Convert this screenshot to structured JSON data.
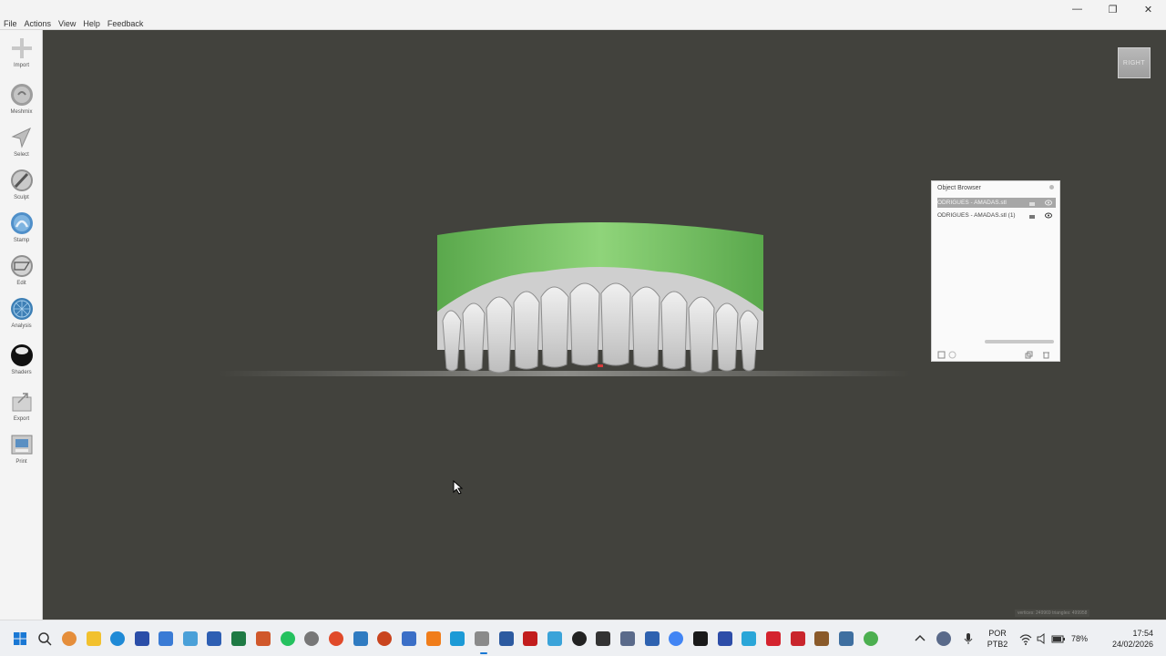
{
  "menu": [
    "File",
    "Actions",
    "View",
    "Help",
    "Feedback"
  ],
  "window_controls": {
    "minimize": "—",
    "restore": "❐",
    "close": "✕"
  },
  "tools": [
    {
      "label": "Import",
      "icon": "plus-icon"
    },
    {
      "label": "Meshmix",
      "icon": "meshmix-icon"
    },
    {
      "label": "Select",
      "icon": "select-arrow-icon"
    },
    {
      "label": "Sculpt",
      "icon": "brush-icon"
    },
    {
      "label": "Stamp",
      "icon": "stamp-icon"
    },
    {
      "label": "Edit",
      "icon": "edit-icon"
    },
    {
      "label": "Analysis",
      "icon": "analysis-icon"
    },
    {
      "label": "Shaders",
      "icon": "shader-sphere-icon"
    },
    {
      "label": "Export",
      "icon": "export-icon"
    },
    {
      "label": "Print",
      "icon": "print-icon"
    }
  ],
  "view_cube": {
    "label": "RIGHT"
  },
  "object_browser": {
    "title": "Object Browser",
    "items": [
      {
        "name": "ODRIGUES - AMADAS.stl",
        "selected": true
      },
      {
        "name": "ODRIGUES - AMADAS.stl (1)",
        "selected": false
      }
    ]
  },
  "status": {
    "info": "vertices: 249969 triangles: 499958"
  },
  "tray": {
    "lang_line1": "POR",
    "lang_line2": "PTB2",
    "battery": "78%",
    "time": "17:54",
    "date": "24/02/2026"
  },
  "colors": {
    "viewport_bg": "#42423d",
    "gum_green": "#6fbf5e",
    "tooth_white": "#e3e3e3",
    "toolbar_bg": "#f4f4f4"
  }
}
